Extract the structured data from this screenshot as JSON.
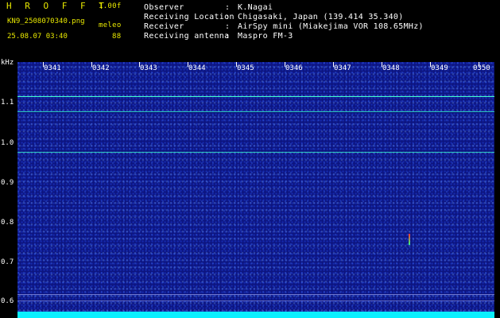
{
  "header": {
    "logo": "H R O F F T",
    "version": "1.00f",
    "filename": "KN9_2508070340.png",
    "program": "meleo",
    "datetime": "25.08.07 03:40",
    "number": "88",
    "fields": [
      {
        "label": "Observer",
        "value": "K.Nagai"
      },
      {
        "label": "Receiving Location",
        "value": "Chigasaki, Japan (139.414 35.340)"
      },
      {
        "label": "Receiver",
        "value": "AirSpy mini (Miakejima VOR 108.65MHz)"
      },
      {
        "label": "Receiving antenna",
        "value": "Maspro FM-3"
      }
    ],
    "separator": ":"
  },
  "spectrogram": {
    "unit": "kHz",
    "time_ticks": [
      "0341",
      "0342",
      "0343",
      "0344",
      "0345",
      "0346",
      "0347",
      "0348",
      "0349",
      "0350"
    ],
    "freq_ticks": [
      "1.1",
      "1.0",
      "0.9",
      "0.8",
      "0.7",
      "0.6"
    ],
    "colors": {
      "background": "#0d1580",
      "signal": "#40ffd0",
      "strip": "#0af0ff"
    }
  }
}
